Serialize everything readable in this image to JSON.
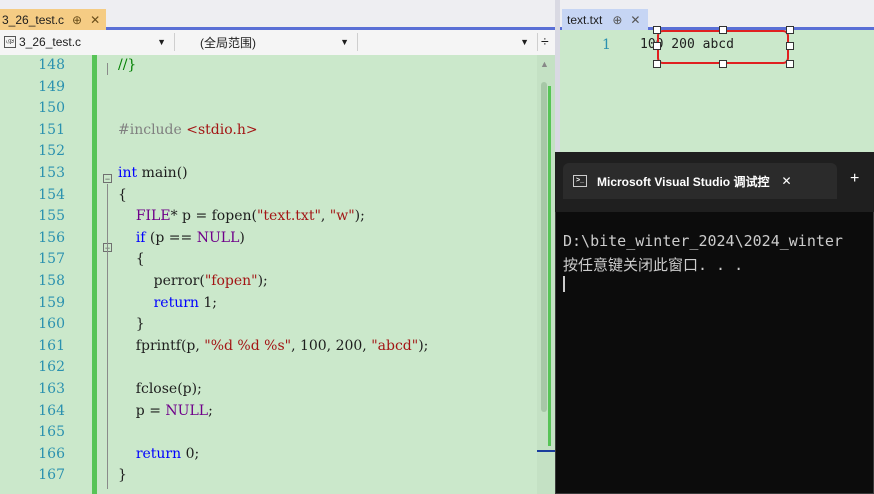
{
  "left_editor": {
    "tab_title": "3_26_test.c",
    "tab_pin": "⊕",
    "tab_close": "✕",
    "tab_icons": "▾ ⚙",
    "nav_file": "3_26_test.c",
    "nav_scope": "(全局范围)",
    "nav_member": "",
    "lines": [
      {
        "num": "148",
        "text": "//}"
      },
      {
        "num": "149",
        "text": ""
      },
      {
        "num": "150",
        "text": ""
      },
      {
        "num": "151",
        "text": "#include <stdio.h>"
      },
      {
        "num": "152",
        "text": ""
      },
      {
        "num": "153",
        "text": "int main()"
      },
      {
        "num": "154",
        "text": "{"
      },
      {
        "num": "155",
        "text": "    FILE* p = fopen(\"text.txt\", \"w\");"
      },
      {
        "num": "156",
        "text": "    if (p == NULL)"
      },
      {
        "num": "157",
        "text": "    {"
      },
      {
        "num": "158",
        "text": "        perror(\"fopen\");"
      },
      {
        "num": "159",
        "text": "        return 1;"
      },
      {
        "num": "160",
        "text": "    }"
      },
      {
        "num": "161",
        "text": "    fprintf(p, \"%d %d %s\", 100, 200, \"abcd\");"
      },
      {
        "num": "162",
        "text": ""
      },
      {
        "num": "163",
        "text": "    fclose(p);"
      },
      {
        "num": "164",
        "text": "    p = NULL;"
      },
      {
        "num": "165",
        "text": ""
      },
      {
        "num": "166",
        "text": "    return 0;"
      },
      {
        "num": "167",
        "text": "}"
      }
    ]
  },
  "right_editor": {
    "tab_title": "text.txt",
    "tab_pin": "⊕",
    "tab_close": "✕",
    "line_num": "1",
    "line_text": "100 200 abcd"
  },
  "console": {
    "title": "Microsoft Visual Studio 调试控",
    "close": "✕",
    "new_tab": "+",
    "line1": "D:\\bite_winter_2024\\2024_winter",
    "line2": "按任意键关闭此窗口. . ."
  },
  "colors": {
    "editor_bg": "#cbe8cb",
    "tab_active": "#f5cc84",
    "line_number": "#2b91af",
    "console_bg": "#0c0c0c"
  }
}
